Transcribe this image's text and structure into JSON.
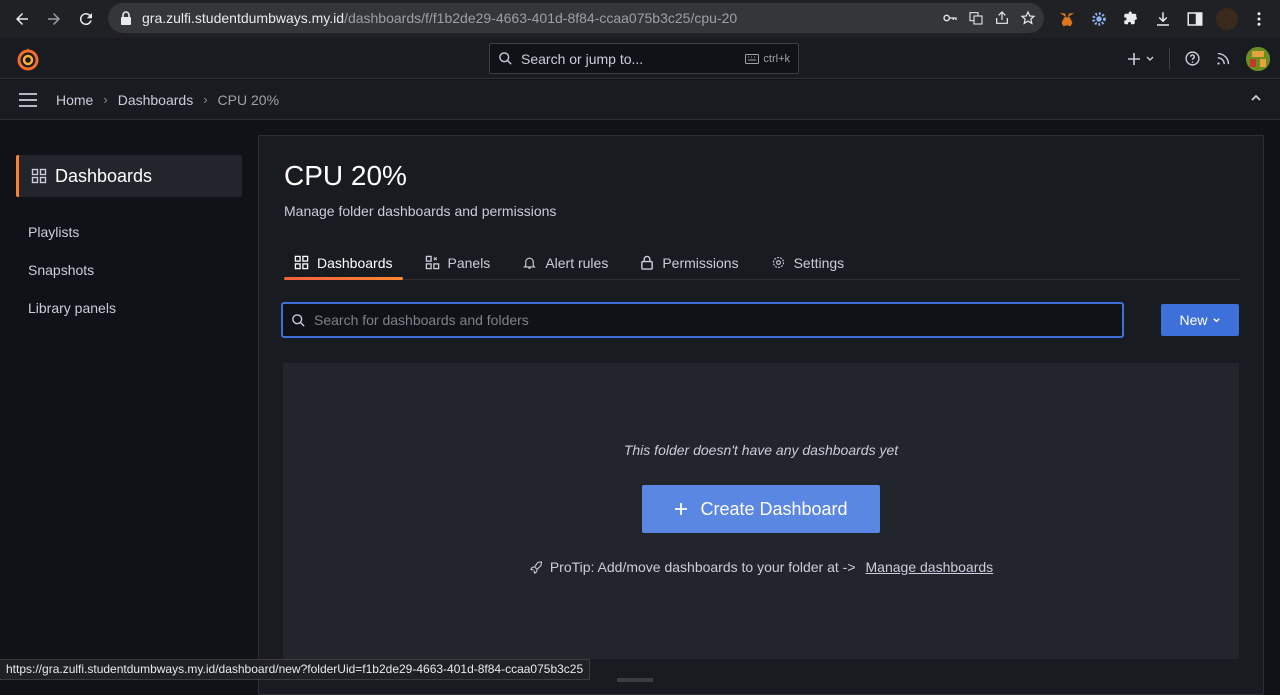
{
  "browser": {
    "url_host": "gra.zulfi.studentdumbways.my.id",
    "url_path": "/dashboards/f/f1b2de29-4663-401d-8f84-ccaa075b3c25/cpu-20",
    "status_url": "https://gra.zulfi.studentdumbways.my.id/dashboard/new?folderUid=f1b2de29-4663-401d-8f84-ccaa075b3c25"
  },
  "topbar": {
    "search_placeholder": "Search or jump to...",
    "shortcut": "ctrl+k"
  },
  "breadcrumb": {
    "items": [
      "Home",
      "Dashboards",
      "CPU 20%"
    ]
  },
  "sidebar": {
    "section": "Dashboards",
    "items": [
      {
        "label": "Playlists"
      },
      {
        "label": "Snapshots"
      },
      {
        "label": "Library panels"
      }
    ]
  },
  "page": {
    "title": "CPU 20%",
    "subtitle": "Manage folder dashboards and permissions",
    "tabs": [
      {
        "label": "Dashboards",
        "icon": "apps-icon",
        "active": true
      },
      {
        "label": "Panels",
        "icon": "panels-icon",
        "active": false
      },
      {
        "label": "Alert rules",
        "icon": "bell-icon",
        "active": false
      },
      {
        "label": "Permissions",
        "icon": "lock-icon",
        "active": false
      },
      {
        "label": "Settings",
        "icon": "cog-icon",
        "active": false
      }
    ],
    "search_placeholder": "Search for dashboards and folders",
    "new_button": "New",
    "empty_message": "This folder doesn't have any dashboards yet",
    "create_button": "Create Dashboard",
    "protip_text": "ProTip: Add/move dashboards to your folder at ->",
    "protip_link": "Manage dashboards"
  },
  "colors": {
    "accent_blue": "#3d71d9",
    "active_tab_orange": "#ff7e33",
    "background": "#111217",
    "panel": "#181b1f"
  }
}
